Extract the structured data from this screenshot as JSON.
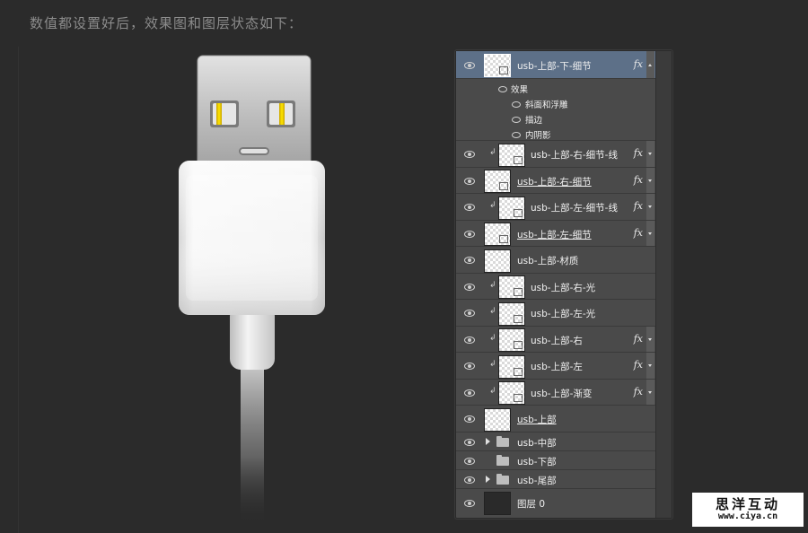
{
  "caption": "数值都设置好后，效果图和图层状态如下：",
  "layers_panel": {
    "layers": [
      {
        "name": "usb-上部-下-细节",
        "fx": "fx",
        "selected": true,
        "clipped": false,
        "underline": false,
        "thumb": "pattern"
      },
      {
        "name": "usb-上部-右-细节-线",
        "fx": "fx",
        "selected": false,
        "clipped": true,
        "underline": false,
        "thumb": "pattern"
      },
      {
        "name": "usb-上部-右-细节",
        "fx": "fx",
        "selected": false,
        "clipped": false,
        "underline": true,
        "thumb": "pattern"
      },
      {
        "name": "usb-上部-左-细节-线",
        "fx": "fx",
        "selected": false,
        "clipped": true,
        "underline": false,
        "thumb": "pattern"
      },
      {
        "name": "usb-上部-左-细节",
        "fx": "fx",
        "selected": false,
        "clipped": false,
        "underline": true,
        "thumb": "pattern"
      },
      {
        "name": "usb-上部-材质",
        "fx": "",
        "selected": false,
        "clipped": false,
        "underline": false,
        "thumb": "pattern"
      },
      {
        "name": "usb-上部-右-光",
        "fx": "",
        "selected": false,
        "clipped": true,
        "underline": false,
        "thumb": "pattern"
      },
      {
        "name": "usb-上部-左-光",
        "fx": "",
        "selected": false,
        "clipped": true,
        "underline": false,
        "thumb": "pattern"
      },
      {
        "name": "usb-上部-右",
        "fx": "fx",
        "selected": false,
        "clipped": true,
        "underline": false,
        "thumb": "pattern"
      },
      {
        "name": "usb-上部-左",
        "fx": "fx",
        "selected": false,
        "clipped": true,
        "underline": false,
        "thumb": "pattern"
      },
      {
        "name": "usb-上部-渐变",
        "fx": "fx",
        "selected": false,
        "clipped": true,
        "underline": false,
        "thumb": "pattern"
      },
      {
        "name": "usb-上部",
        "fx": "",
        "selected": false,
        "clipped": false,
        "underline": true,
        "thumb": "pattern"
      }
    ],
    "effects": {
      "title": "效果",
      "items": [
        "斜面和浮雕",
        "描边",
        "内阴影"
      ]
    },
    "groups": [
      "usb-中部",
      "usb-下部",
      "usb-尾部"
    ],
    "background_layer": "图层 0"
  },
  "watermark": {
    "name": "思洋互动",
    "url": "www.ciya.cn"
  }
}
